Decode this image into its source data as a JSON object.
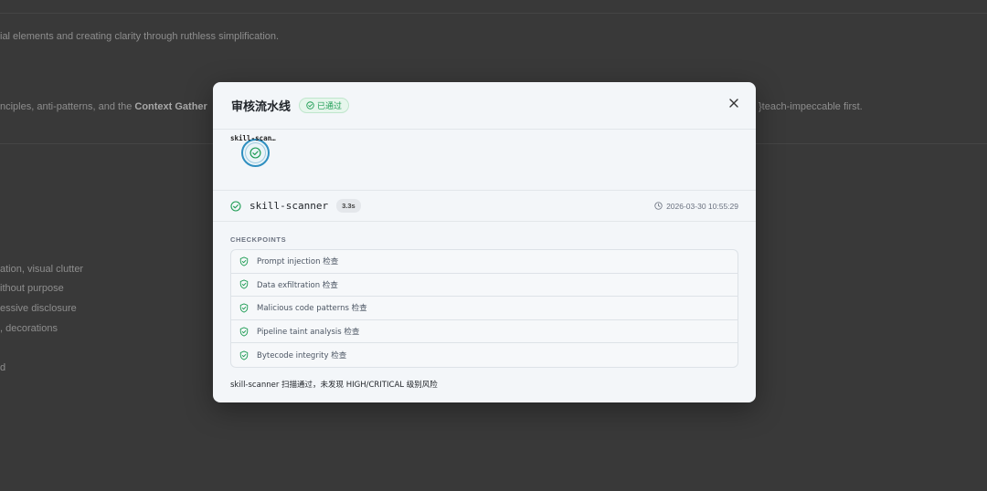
{
  "background": {
    "lines": [
      "ial elements and creating clarity through ruthless simplification.",
      "nciples, anti-patterns, and the ",
      "Context Gather",
      "}teach-impeccable first.",
      "ation, visual clutter",
      "ithout purpose",
      "essive disclosure",
      ", decorations",
      "d"
    ]
  },
  "modal": {
    "title": "审核流水线",
    "status_badge": "已通过",
    "pipeline": {
      "stages": [
        {
          "label": "skill-scan…"
        }
      ]
    },
    "stage": {
      "name": "skill-scanner",
      "duration": "3.3s",
      "timestamp": "2026-03-30 10:55:29"
    },
    "checkpoints_title": "CHECKPOINTS",
    "checkpoints": [
      {
        "label": "Prompt injection 检查"
      },
      {
        "label": "Data exfiltration 检查"
      },
      {
        "label": "Malicious code patterns 检查"
      },
      {
        "label": "Pipeline taint analysis 检查"
      },
      {
        "label": "Bytecode integrity 检查"
      }
    ],
    "summary": "skill-scanner 扫描通过，未发现 HIGH/CRITICAL 级别风险"
  },
  "colors": {
    "success": "#1f9d55",
    "stage_ring": "#2f8fc0",
    "overlay": "#393939"
  }
}
